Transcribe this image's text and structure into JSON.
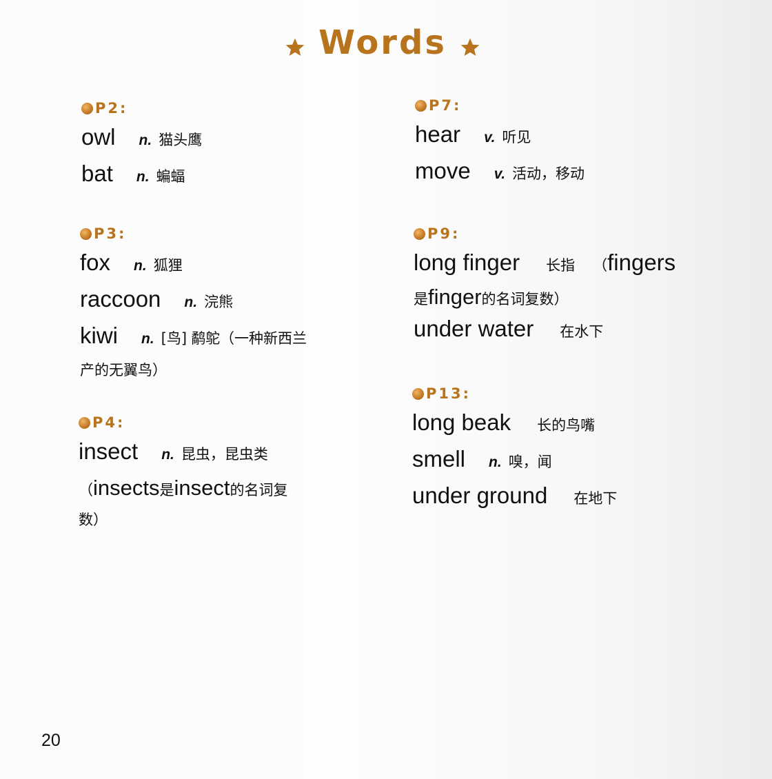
{
  "title": "Words",
  "page_number": "20",
  "colors": {
    "accent": "#b8741c",
    "text": "#111111"
  },
  "sections": {
    "p2": {
      "label": "P2:",
      "entries": [
        {
          "word": "owl",
          "pos": "n.",
          "meaning": "猫头鹰"
        },
        {
          "word": "bat",
          "pos": "n.",
          "meaning": "蝙蝠"
        }
      ]
    },
    "p3": {
      "label": "P3:",
      "entries": [
        {
          "word": "fox",
          "pos": "n.",
          "meaning": "狐狸"
        },
        {
          "word": "raccoon",
          "pos": "n.",
          "meaning": "浣熊"
        },
        {
          "word": "kiwi",
          "pos": "n.",
          "bracket": "[鸟]",
          "meaning": "鹬鸵（一种新西兰",
          "continuation": "产的无翼鸟）"
        }
      ]
    },
    "p4": {
      "label": "P4:",
      "entries": [
        {
          "word": "insect",
          "pos": "n.",
          "meaning": "昆虫，昆虫类"
        }
      ],
      "note_line1": {
        "open": "（",
        "w1": "insects",
        "t1": "是",
        "w2": "insect",
        "t2": "的名词复"
      },
      "note_line2": "数）"
    },
    "p7": {
      "label": "P7:",
      "entries": [
        {
          "word": "hear",
          "pos": "v.",
          "meaning": "听见"
        },
        {
          "word": "move",
          "pos": "v.",
          "meaning": "活动，移动"
        }
      ]
    },
    "p9": {
      "label": "P9:",
      "entries": [
        {
          "word": "long finger",
          "meaning": "长指"
        },
        {
          "word": "under water",
          "meaning": "在水下"
        }
      ],
      "note": {
        "open": "（",
        "w1": "fingers",
        "t1": "是",
        "w2": "finger",
        "t2": "的名词复数）"
      }
    },
    "p13": {
      "label": "P13:",
      "entries": [
        {
          "word": "long beak",
          "meaning": "长的鸟嘴"
        },
        {
          "word": "smell",
          "pos": "n.",
          "meaning": "嗅，闻"
        },
        {
          "word": "under ground",
          "meaning": "在地下"
        }
      ]
    }
  },
  "icons": {
    "title_left": "star-icon",
    "title_right": "star-icon",
    "section_bullet": "dot-icon"
  }
}
